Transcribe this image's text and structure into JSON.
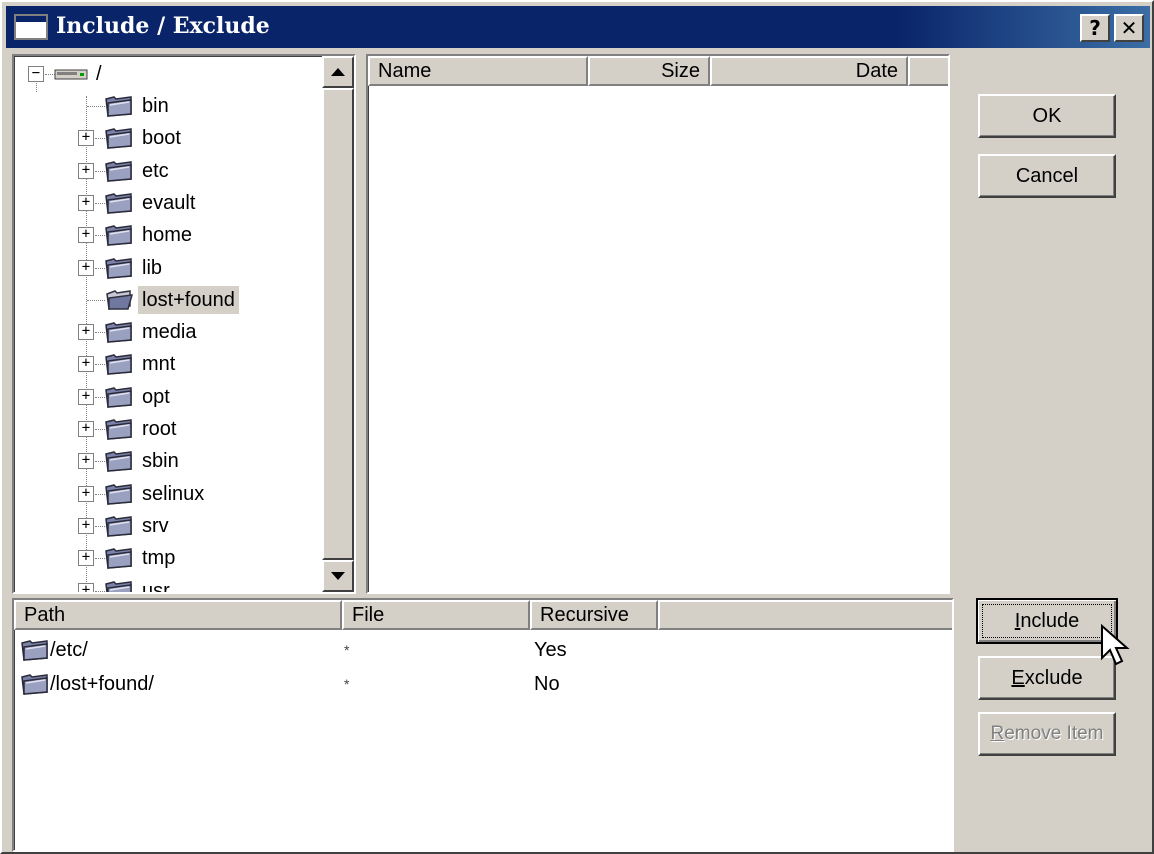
{
  "window": {
    "title": "Include / Exclude",
    "help_button": "?",
    "close_button": "✕"
  },
  "tree": {
    "root_label": "/",
    "items": [
      {
        "label": "bin",
        "expandable": false
      },
      {
        "label": "boot",
        "expandable": true
      },
      {
        "label": "etc",
        "expandable": true
      },
      {
        "label": "evault",
        "expandable": true
      },
      {
        "label": "home",
        "expandable": true
      },
      {
        "label": "lib",
        "expandable": true
      },
      {
        "label": "lost+found",
        "expandable": false,
        "selected": true
      },
      {
        "label": "media",
        "expandable": true
      },
      {
        "label": "mnt",
        "expandable": true
      },
      {
        "label": "opt",
        "expandable": true
      },
      {
        "label": "root",
        "expandable": true
      },
      {
        "label": "sbin",
        "expandable": true
      },
      {
        "label": "selinux",
        "expandable": true
      },
      {
        "label": "srv",
        "expandable": true
      },
      {
        "label": "tmp",
        "expandable": true
      },
      {
        "label": "usr",
        "expandable": true
      }
    ]
  },
  "files": {
    "columns": [
      "Name",
      "Size",
      "Date"
    ]
  },
  "paths": {
    "columns": [
      "Path",
      "File",
      "Recursive"
    ],
    "rows": [
      {
        "path": "/etc/",
        "file": "*",
        "recursive": "Yes"
      },
      {
        "path": "/lost+found/",
        "file": "*",
        "recursive": "No"
      }
    ]
  },
  "buttons": {
    "ok": "OK",
    "cancel": "Cancel",
    "include_first": "I",
    "include_rest": "nclude",
    "exclude_first": "E",
    "exclude_rest": "xclude",
    "remove_first": "R",
    "remove_rest": "emove Item"
  }
}
